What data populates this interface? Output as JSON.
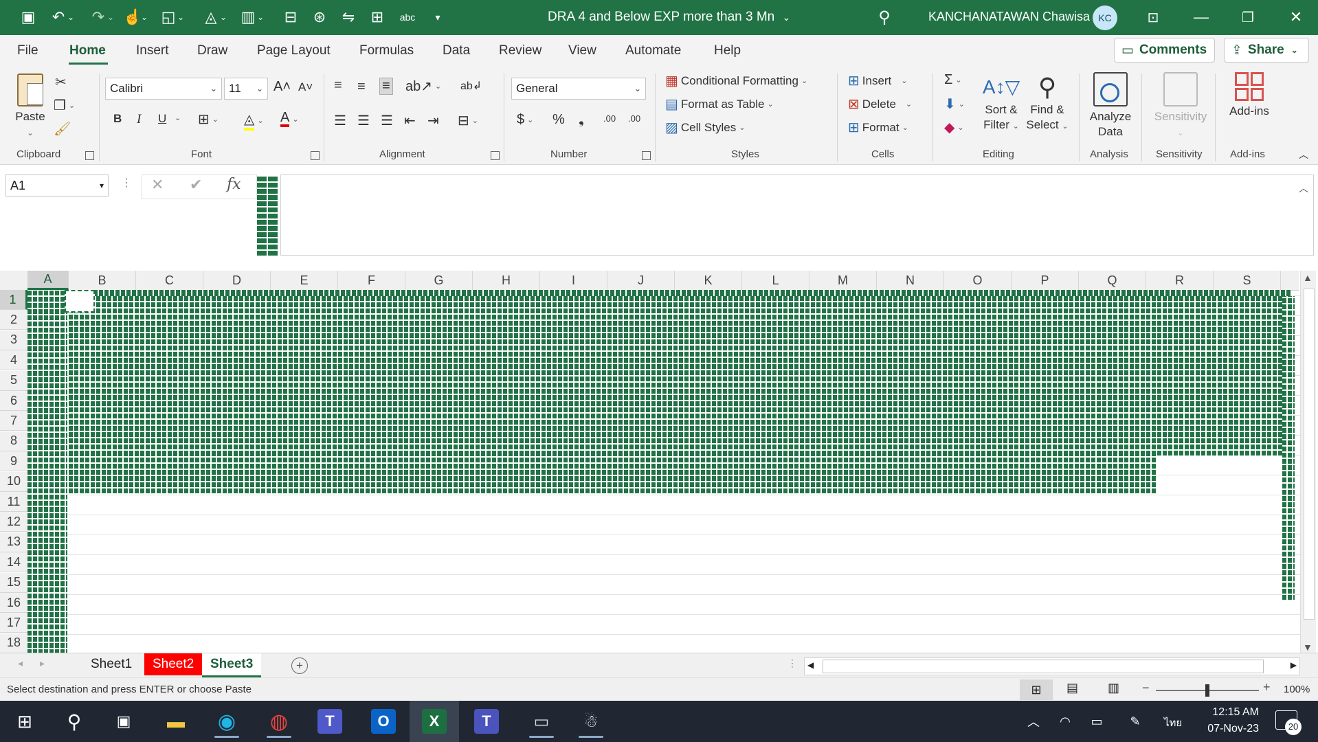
{
  "titlebar": {
    "doc_title": "DRA 4 and Below EXP more than 3 Mn",
    "user_name": "KANCHANATAWAN Chawisa",
    "avatar_initials": "KC",
    "quick_access": [
      "save-icon",
      "undo-icon",
      "redo-icon",
      "touch-mode-icon",
      "shapes-icon",
      "fill-icon",
      "freeze-icon",
      "format-icon",
      "accessibility-icon",
      "translate-icon",
      "table-icon",
      "spelling-icon",
      "customize-icon"
    ]
  },
  "menu": {
    "tabs": [
      "File",
      "Home",
      "Insert",
      "Draw",
      "Page Layout",
      "Formulas",
      "Data",
      "Review",
      "View",
      "Automate",
      "Help"
    ],
    "active": "Home",
    "comments_label": "Comments",
    "share_label": "Share"
  },
  "ribbon": {
    "clipboard": {
      "paste": "Paste",
      "label": "Clipboard"
    },
    "font": {
      "name": "Calibri",
      "size": "11",
      "bold": "B",
      "italic": "I",
      "underline": "U",
      "label": "Font"
    },
    "alignment": {
      "label": "Alignment"
    },
    "number": {
      "format": "General",
      "currency": "$",
      "percent": "%",
      "comma": "❟",
      "inc_decimal": ".00",
      "dec_decimal": ".00",
      "label": "Number"
    },
    "styles": {
      "conditional": "Conditional Formatting",
      "format_table": "Format as Table",
      "cell_styles": "Cell Styles",
      "label": "Styles"
    },
    "cells": {
      "insert": "Insert",
      "delete": "Delete",
      "format": "Format",
      "label": "Cells"
    },
    "editing": {
      "sort_line1": "Sort &",
      "sort_line2": "Filter",
      "find_line1": "Find &",
      "find_line2": "Select",
      "label": "Editing"
    },
    "analysis": {
      "line1": "Analyze",
      "line2": "Data",
      "label": "Analysis"
    },
    "sensitivity": {
      "text": "Sensitivity",
      "label": "Sensitivity"
    },
    "addins": {
      "text": "Add-ins",
      "label": "Add-ins"
    }
  },
  "formula_bar": {
    "name_box": "A1",
    "fx": "fx"
  },
  "grid": {
    "columns": [
      "A",
      "B",
      "C",
      "D",
      "E",
      "F",
      "G",
      "H",
      "I",
      "J",
      "K",
      "L",
      "M",
      "N",
      "O",
      "P",
      "Q",
      "R",
      "S"
    ],
    "rows": [
      "1",
      "2",
      "3",
      "4",
      "5",
      "6",
      "7",
      "8",
      "9",
      "10",
      "11",
      "12",
      "13",
      "14",
      "15",
      "16",
      "17",
      "18"
    ],
    "selected_column": "A",
    "selected_row": "1"
  },
  "sheets": {
    "tabs": [
      "Sheet1",
      "Sheet2",
      "Sheet3"
    ],
    "active": "Sheet3",
    "sheet2_color": "#ff0000"
  },
  "status": {
    "message": "Select destination and press ENTER or choose Paste",
    "zoom": "100%"
  },
  "taskbar": {
    "time": "12:15 AM",
    "date": "07-Nov-23",
    "language": "ไทย",
    "notifications": "20",
    "apps": [
      "windows-start-icon",
      "search-icon",
      "task-view-icon",
      "file-explorer-icon",
      "edge-icon",
      "chrome-icon",
      "teams-icon",
      "outlook-icon",
      "excel-icon",
      "teams-new-icon",
      "terminal-icon",
      "pdf24-icon"
    ]
  },
  "colors": {
    "excel_green": "#217346",
    "taskbar": "#202733"
  }
}
